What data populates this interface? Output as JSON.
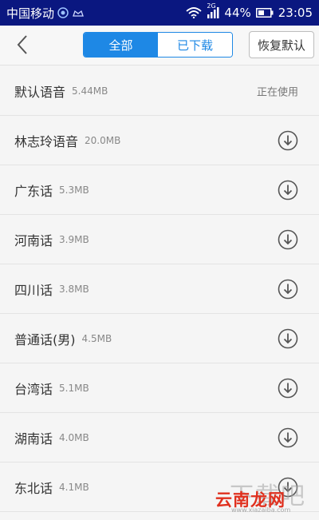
{
  "status_bar": {
    "carrier": "中国移动",
    "network_type": "2G",
    "battery": "44%",
    "time": "23:05",
    "icons": [
      "smile-icon",
      "cloud-icon",
      "wifi-icon",
      "signal-icon",
      "battery-icon"
    ]
  },
  "header": {
    "back_icon": "chevron-left-icon",
    "tabs": [
      {
        "label": "全部",
        "active": true
      },
      {
        "label": "已下载",
        "active": false
      }
    ],
    "restore_label": "恢复默认"
  },
  "voices": [
    {
      "name": "默认语音",
      "size": "5.44MB",
      "status": "正在使用"
    },
    {
      "name": "林志玲语音",
      "size": "20.0MB",
      "status": "download"
    },
    {
      "name": "广东话",
      "size": "5.3MB",
      "status": "download"
    },
    {
      "name": "河南话",
      "size": "3.9MB",
      "status": "download"
    },
    {
      "name": "四川话",
      "size": "3.8MB",
      "status": "download"
    },
    {
      "name": "普通话(男)",
      "size": "4.5MB",
      "status": "download"
    },
    {
      "name": "台湾话",
      "size": "5.1MB",
      "status": "download"
    },
    {
      "name": "湖南话",
      "size": "4.0MB",
      "status": "download"
    },
    {
      "name": "东北话",
      "size": "4.1MB",
      "status": "download"
    }
  ],
  "watermark": {
    "ghost": "下载吧",
    "brand": "云南龙网",
    "url": "www.xiazaiba.com"
  },
  "colors": {
    "status_bar_bg": "#0a1780",
    "accent": "#1e88e5",
    "watermark_red": "#e0301e"
  }
}
